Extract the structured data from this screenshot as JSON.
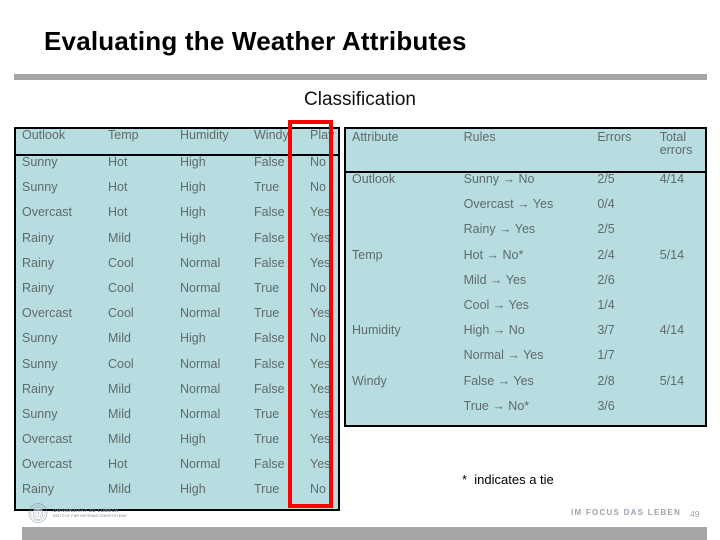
{
  "slide": {
    "title": "Evaluating the Weather Attributes",
    "subtitle": "Classification",
    "tie_note_star": "*",
    "tie_note_text": "indicates a tie",
    "page_number": "49",
    "accent_highlight_color": "#ff0000",
    "table_background_color": "#b8dde0",
    "rule_color": "#a6a6a6"
  },
  "data_table": {
    "headers": [
      "Outlook",
      "Temp",
      "Humidity",
      "Windy",
      "Play"
    ],
    "rows": [
      [
        "Sunny",
        "Hot",
        "High",
        "False",
        "No"
      ],
      [
        "Sunny",
        "Hot",
        "High",
        "True",
        "No"
      ],
      [
        "Overcast",
        "Hot",
        "High",
        "False",
        "Yes"
      ],
      [
        "Rainy",
        "Mild",
        "High",
        "False",
        "Yes"
      ],
      [
        "Rainy",
        "Cool",
        "Normal",
        "False",
        "Yes"
      ],
      [
        "Rainy",
        "Cool",
        "Normal",
        "True",
        "No"
      ],
      [
        "Overcast",
        "Cool",
        "Normal",
        "True",
        "Yes"
      ],
      [
        "Sunny",
        "Mild",
        "High",
        "False",
        "No"
      ],
      [
        "Sunny",
        "Cool",
        "Normal",
        "False",
        "Yes"
      ],
      [
        "Rainy",
        "Mild",
        "Normal",
        "False",
        "Yes"
      ],
      [
        "Sunny",
        "Mild",
        "Normal",
        "True",
        "Yes"
      ],
      [
        "Overcast",
        "Mild",
        "High",
        "True",
        "Yes"
      ],
      [
        "Overcast",
        "Hot",
        "Normal",
        "False",
        "Yes"
      ],
      [
        "Rainy",
        "Mild",
        "High",
        "True",
        "No"
      ]
    ]
  },
  "rules_table": {
    "headers": [
      "Attribute",
      "Rules",
      "Errors",
      "Total errors"
    ],
    "rows": [
      [
        "Outlook",
        "Sunny → No",
        "2/5",
        "4/14"
      ],
      [
        "",
        "Overcast → Yes",
        "0/4",
        ""
      ],
      [
        "",
        "Rainy → Yes",
        "2/5",
        ""
      ],
      [
        "Temp",
        "Hot → No*",
        "2/4",
        "5/14"
      ],
      [
        "",
        "Mild →  Yes",
        "2/6",
        ""
      ],
      [
        "",
        "Cool →  Yes",
        "1/4",
        ""
      ],
      [
        "Humidity",
        "High →  No",
        "3/7",
        "4/14"
      ],
      [
        "",
        "Normal → Yes",
        "1/7",
        ""
      ],
      [
        "Windy",
        "False → Yes",
        "2/8",
        "5/14"
      ],
      [
        "",
        "True → No*",
        "3/6",
        ""
      ]
    ]
  },
  "footer": {
    "logo_line1": "UNIVERSITÄT ZU LÜBECK",
    "logo_line2": "INSTITUT FÜR INFORMATIONSSYSTEME",
    "slogan": "IM FOCUS DAS LEBEN"
  }
}
